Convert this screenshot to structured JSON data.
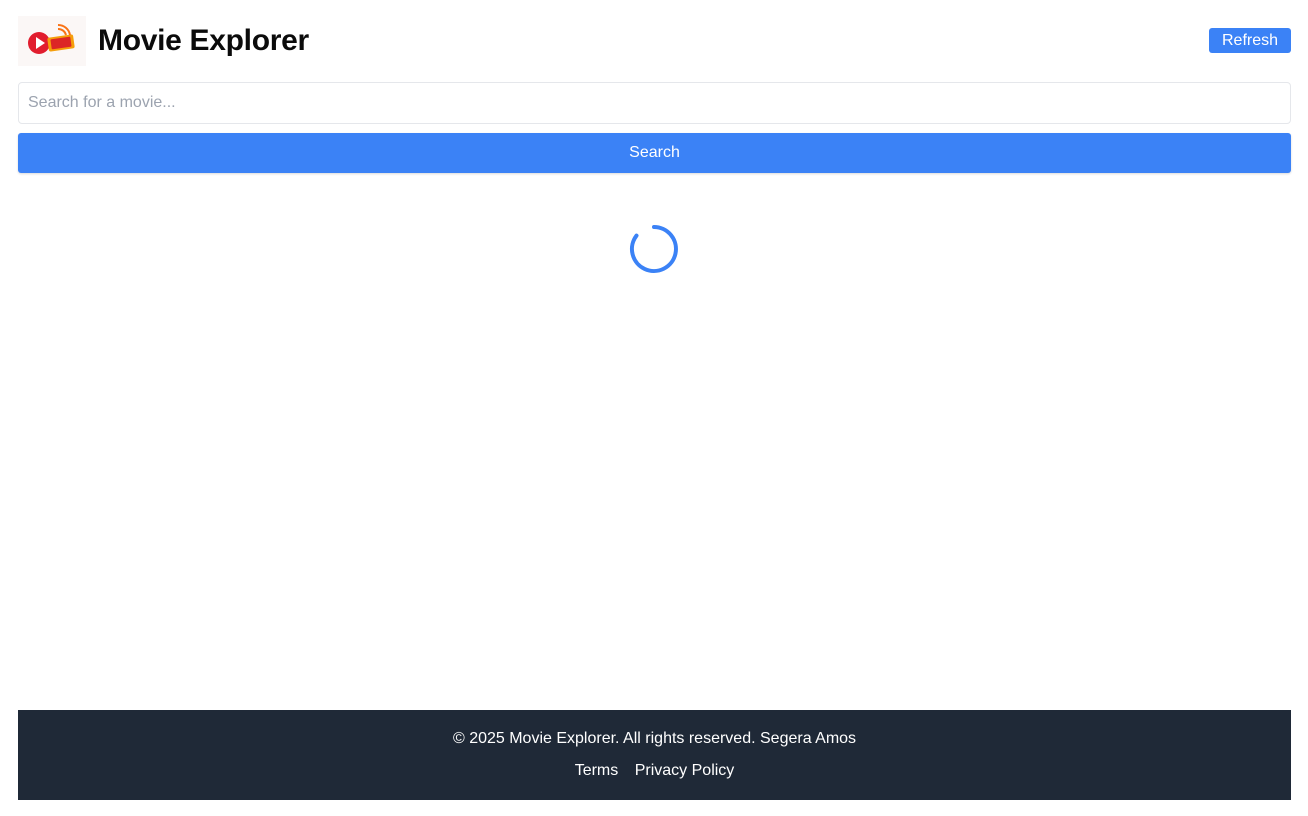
{
  "header": {
    "logo_icon": "movie-live-logo-icon",
    "title": "Movie Explorer",
    "refresh_label": "Refresh"
  },
  "search": {
    "placeholder": "Search for a movie...",
    "value": "",
    "button_label": "Search"
  },
  "loading": {
    "icon": "loading-spinner-icon"
  },
  "footer": {
    "copyright": "© 2025 Movie Explorer. All rights reserved. Segera Amos",
    "links": [
      {
        "label": "Terms"
      },
      {
        "label": "Privacy Policy"
      }
    ]
  },
  "colors": {
    "accent": "#3b82f6",
    "footer_bg": "#1f2937",
    "text": "#0b0b0b"
  }
}
